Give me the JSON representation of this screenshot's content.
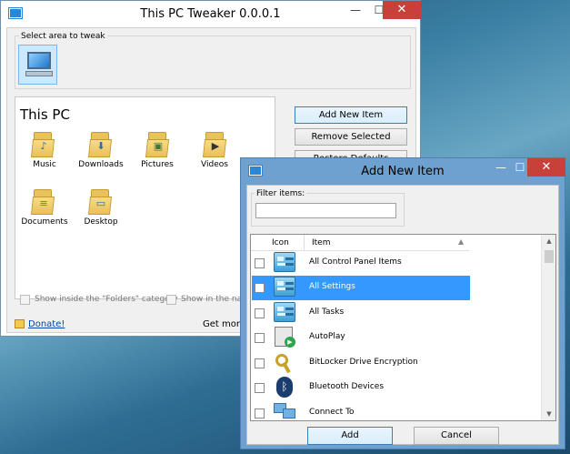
{
  "main_window": {
    "title": "This PC Tweaker 0.0.0.1",
    "select_area_label": "Select area to tweak",
    "panel_title": "This PC",
    "folders": [
      {
        "label": "Music",
        "icon": "music-folder-icon",
        "glyph": "♪"
      },
      {
        "label": "Downloads",
        "icon": "downloads-folder-icon",
        "glyph": "⬇"
      },
      {
        "label": "Pictures",
        "icon": "pictures-folder-icon",
        "glyph": "▣"
      },
      {
        "label": "Videos",
        "icon": "videos-folder-icon",
        "glyph": "▶"
      },
      {
        "label": "Documents",
        "icon": "documents-folder-icon",
        "glyph": "≡"
      },
      {
        "label": "Desktop",
        "icon": "desktop-folder-icon",
        "glyph": "▭"
      }
    ],
    "buttons": {
      "add": "Add New Item",
      "remove": "Remove Selected",
      "restore": "Restore Defaults"
    },
    "options": {
      "show_folders": "Show inside the \"Folders\" category",
      "show_nav": "Show in the navi"
    },
    "donate_label": "Donate!",
    "get_more_label": "Get more"
  },
  "dialog": {
    "title": "Add New Item",
    "filter_label": "Filter items:",
    "filter_value": "",
    "columns": {
      "icon": "Icon",
      "item": "Item"
    },
    "items": [
      {
        "label": "All Control Panel Items",
        "icon": "control-panel-icon",
        "selected": false
      },
      {
        "label": "All Settings",
        "icon": "settings-icon",
        "selected": true
      },
      {
        "label": "All Tasks",
        "icon": "tasks-icon",
        "selected": false
      },
      {
        "label": "AutoPlay",
        "icon": "autoplay-icon",
        "selected": false
      },
      {
        "label": "BitLocker Drive Encryption",
        "icon": "bitlocker-key-icon",
        "selected": false
      },
      {
        "label": "Bluetooth Devices",
        "icon": "bluetooth-icon",
        "selected": false
      },
      {
        "label": "Connect To",
        "icon": "connect-to-icon",
        "selected": false
      }
    ],
    "buttons": {
      "add": "Add",
      "cancel": "Cancel"
    }
  },
  "colors": {
    "titlebar": "#ffffff",
    "dialog_titlebar": "#6ea1cf",
    "close": "#c7413a",
    "selection": "#3399ff"
  }
}
